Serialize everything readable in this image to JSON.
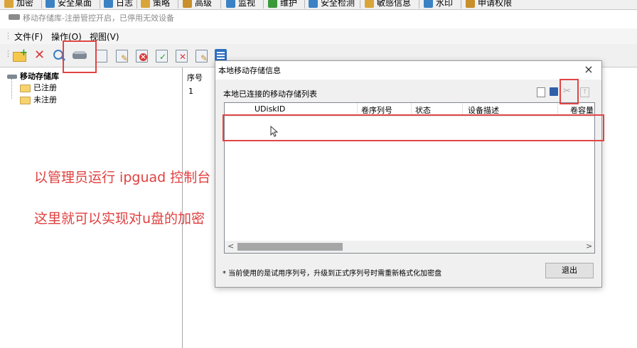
{
  "top_menu": [
    {
      "label": "加密",
      "color": "#d9a53a"
    },
    {
      "label": "安全桌面",
      "color": "#3b82c4"
    },
    {
      "label": "日志",
      "color": "#3b82c4"
    },
    {
      "label": "策略",
      "color": "#d9a53a"
    },
    {
      "label": "高级",
      "color": "#c88f2a"
    },
    {
      "label": "监视",
      "color": "#3b82c4"
    },
    {
      "label": "维护",
      "color": "#3a9a3a"
    },
    {
      "label": "安全检测",
      "color": "#3b82c4"
    },
    {
      "label": "敏感信息",
      "color": "#d9a53a"
    },
    {
      "label": "水印",
      "color": "#3b82c4"
    },
    {
      "label": "申请权限",
      "color": "#c88f2a"
    }
  ],
  "window": {
    "title": "移动存储库-注册管控开启，已停用无效设备"
  },
  "menubar": {
    "file": "文件(F)",
    "operate": "操作(O)",
    "view": "视图(V)"
  },
  "toolbar": {
    "icons": [
      "new-folder-icon",
      "delete-icon",
      "search-icon",
      "drive-icon",
      "device-info-icon",
      "edit-icon",
      "cancel-icon",
      "check-icon",
      "remove-icon",
      "edit-doc-icon",
      "list-view-icon"
    ]
  },
  "tree": {
    "root": "移动存储库",
    "children": [
      "已注册",
      "未注册"
    ]
  },
  "list": {
    "header": "序号",
    "rows": [
      "1"
    ]
  },
  "annotations": {
    "line1": "以管理员运行 ipguad 控制台",
    "line2": "这里就可以实现对u盘的加密"
  },
  "dialog": {
    "title": "本地移动存储信息",
    "close": "×",
    "group_title": "本地已连接的移动存储列表",
    "columns": [
      "UDiskID",
      "卷序列号",
      "状态",
      "设备描述",
      "卷容量"
    ],
    "footnote": "* 当前使用的是试用序列号，升级到正式序列号时需重新格式化加密盘",
    "exit_label": "退出",
    "scroll_left": "<",
    "scroll_right": ">"
  },
  "colors": {
    "annotation": "#e04040",
    "accent": "#3b82c4"
  }
}
